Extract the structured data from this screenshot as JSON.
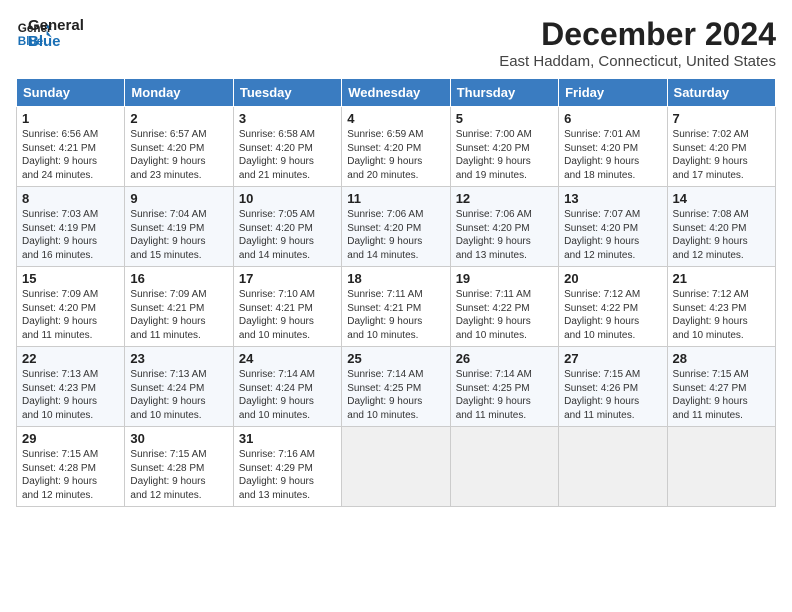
{
  "header": {
    "logo_line1": "General",
    "logo_line2": "Blue",
    "main_title": "December 2024",
    "subtitle": "East Haddam, Connecticut, United States"
  },
  "calendar": {
    "columns": [
      "Sunday",
      "Monday",
      "Tuesday",
      "Wednesday",
      "Thursday",
      "Friday",
      "Saturday"
    ],
    "weeks": [
      [
        {
          "day": "1",
          "info": "Sunrise: 6:56 AM\nSunset: 4:21 PM\nDaylight: 9 hours\nand 24 minutes."
        },
        {
          "day": "2",
          "info": "Sunrise: 6:57 AM\nSunset: 4:20 PM\nDaylight: 9 hours\nand 23 minutes."
        },
        {
          "day": "3",
          "info": "Sunrise: 6:58 AM\nSunset: 4:20 PM\nDaylight: 9 hours\nand 21 minutes."
        },
        {
          "day": "4",
          "info": "Sunrise: 6:59 AM\nSunset: 4:20 PM\nDaylight: 9 hours\nand 20 minutes."
        },
        {
          "day": "5",
          "info": "Sunrise: 7:00 AM\nSunset: 4:20 PM\nDaylight: 9 hours\nand 19 minutes."
        },
        {
          "day": "6",
          "info": "Sunrise: 7:01 AM\nSunset: 4:20 PM\nDaylight: 9 hours\nand 18 minutes."
        },
        {
          "day": "7",
          "info": "Sunrise: 7:02 AM\nSunset: 4:20 PM\nDaylight: 9 hours\nand 17 minutes."
        }
      ],
      [
        {
          "day": "8",
          "info": "Sunrise: 7:03 AM\nSunset: 4:19 PM\nDaylight: 9 hours\nand 16 minutes."
        },
        {
          "day": "9",
          "info": "Sunrise: 7:04 AM\nSunset: 4:19 PM\nDaylight: 9 hours\nand 15 minutes."
        },
        {
          "day": "10",
          "info": "Sunrise: 7:05 AM\nSunset: 4:20 PM\nDaylight: 9 hours\nand 14 minutes."
        },
        {
          "day": "11",
          "info": "Sunrise: 7:06 AM\nSunset: 4:20 PM\nDaylight: 9 hours\nand 14 minutes."
        },
        {
          "day": "12",
          "info": "Sunrise: 7:06 AM\nSunset: 4:20 PM\nDaylight: 9 hours\nand 13 minutes."
        },
        {
          "day": "13",
          "info": "Sunrise: 7:07 AM\nSunset: 4:20 PM\nDaylight: 9 hours\nand 12 minutes."
        },
        {
          "day": "14",
          "info": "Sunrise: 7:08 AM\nSunset: 4:20 PM\nDaylight: 9 hours\nand 12 minutes."
        }
      ],
      [
        {
          "day": "15",
          "info": "Sunrise: 7:09 AM\nSunset: 4:20 PM\nDaylight: 9 hours\nand 11 minutes."
        },
        {
          "day": "16",
          "info": "Sunrise: 7:09 AM\nSunset: 4:21 PM\nDaylight: 9 hours\nand 11 minutes."
        },
        {
          "day": "17",
          "info": "Sunrise: 7:10 AM\nSunset: 4:21 PM\nDaylight: 9 hours\nand 10 minutes."
        },
        {
          "day": "18",
          "info": "Sunrise: 7:11 AM\nSunset: 4:21 PM\nDaylight: 9 hours\nand 10 minutes."
        },
        {
          "day": "19",
          "info": "Sunrise: 7:11 AM\nSunset: 4:22 PM\nDaylight: 9 hours\nand 10 minutes."
        },
        {
          "day": "20",
          "info": "Sunrise: 7:12 AM\nSunset: 4:22 PM\nDaylight: 9 hours\nand 10 minutes."
        },
        {
          "day": "21",
          "info": "Sunrise: 7:12 AM\nSunset: 4:23 PM\nDaylight: 9 hours\nand 10 minutes."
        }
      ],
      [
        {
          "day": "22",
          "info": "Sunrise: 7:13 AM\nSunset: 4:23 PM\nDaylight: 9 hours\nand 10 minutes."
        },
        {
          "day": "23",
          "info": "Sunrise: 7:13 AM\nSunset: 4:24 PM\nDaylight: 9 hours\nand 10 minutes."
        },
        {
          "day": "24",
          "info": "Sunrise: 7:14 AM\nSunset: 4:24 PM\nDaylight: 9 hours\nand 10 minutes."
        },
        {
          "day": "25",
          "info": "Sunrise: 7:14 AM\nSunset: 4:25 PM\nDaylight: 9 hours\nand 10 minutes."
        },
        {
          "day": "26",
          "info": "Sunrise: 7:14 AM\nSunset: 4:25 PM\nDaylight: 9 hours\nand 11 minutes."
        },
        {
          "day": "27",
          "info": "Sunrise: 7:15 AM\nSunset: 4:26 PM\nDaylight: 9 hours\nand 11 minutes."
        },
        {
          "day": "28",
          "info": "Sunrise: 7:15 AM\nSunset: 4:27 PM\nDaylight: 9 hours\nand 11 minutes."
        }
      ],
      [
        {
          "day": "29",
          "info": "Sunrise: 7:15 AM\nSunset: 4:28 PM\nDaylight: 9 hours\nand 12 minutes."
        },
        {
          "day": "30",
          "info": "Sunrise: 7:15 AM\nSunset: 4:28 PM\nDaylight: 9 hours\nand 12 minutes."
        },
        {
          "day": "31",
          "info": "Sunrise: 7:16 AM\nSunset: 4:29 PM\nDaylight: 9 hours\nand 13 minutes."
        },
        {
          "day": "",
          "info": ""
        },
        {
          "day": "",
          "info": ""
        },
        {
          "day": "",
          "info": ""
        },
        {
          "day": "",
          "info": ""
        }
      ]
    ]
  }
}
